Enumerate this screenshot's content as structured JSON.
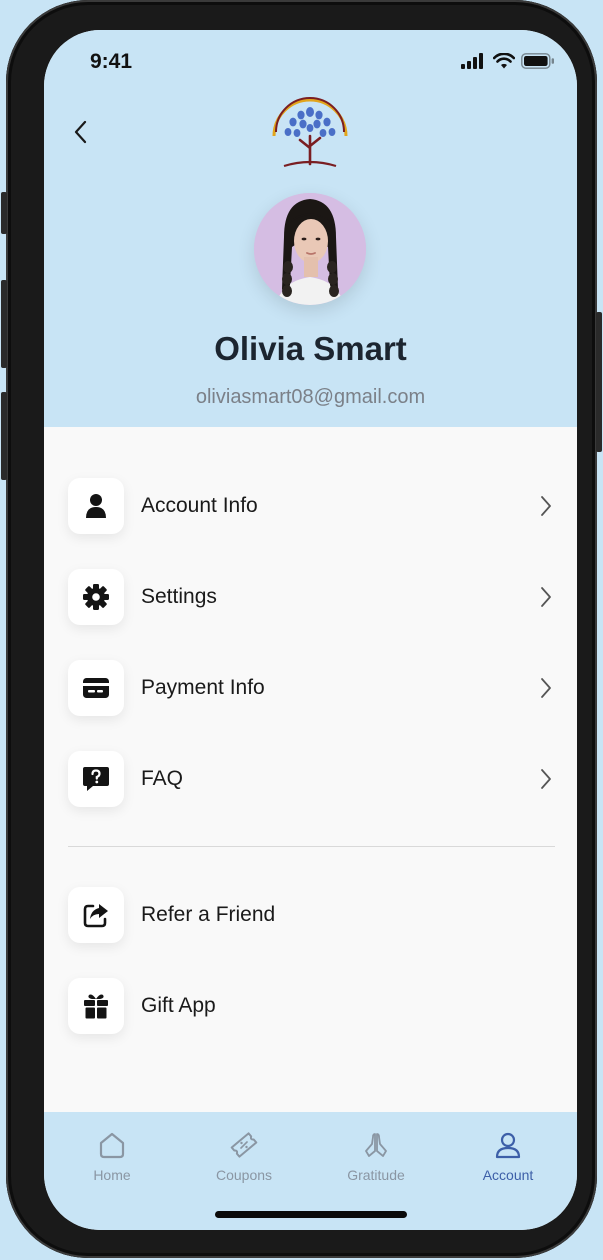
{
  "status_bar": {
    "time": "9:41"
  },
  "profile": {
    "name": "Olivia Smart",
    "email": "oliviasmart08@gmail.com"
  },
  "menu": {
    "primary": [
      {
        "label": "Account Info",
        "icon": "user-icon"
      },
      {
        "label": "Settings",
        "icon": "gear-icon"
      },
      {
        "label": "Payment Info",
        "icon": "credit-card-icon"
      },
      {
        "label": "FAQ",
        "icon": "question-bubble-icon"
      }
    ],
    "secondary": [
      {
        "label": "Refer a Friend",
        "icon": "share-icon"
      },
      {
        "label": "Gift App",
        "icon": "gift-icon"
      }
    ]
  },
  "tabbar": {
    "tabs": [
      {
        "label": "Home",
        "icon": "home-icon"
      },
      {
        "label": "Coupons",
        "icon": "ticket-icon"
      },
      {
        "label": "Gratitude",
        "icon": "praying-hands-icon"
      },
      {
        "label": "Account",
        "icon": "account-icon"
      }
    ],
    "active": "Account"
  },
  "colors": {
    "header_bg": "#c8e4f5",
    "content_bg": "#f9f9f9",
    "active_tab": "#3d5fa8",
    "inactive_tab": "#8a96a3"
  }
}
